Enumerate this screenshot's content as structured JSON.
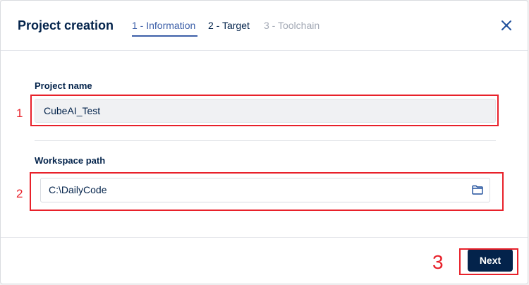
{
  "dialog": {
    "title": "Project creation",
    "close_icon": "close-icon"
  },
  "tabs": [
    {
      "label": "1 - Information",
      "state": "active"
    },
    {
      "label": "2 - Target",
      "state": "enabled"
    },
    {
      "label": "3 - Toolchain",
      "state": "disabled"
    }
  ],
  "form": {
    "project_name": {
      "label": "Project name",
      "value": "CubeAI_Test"
    },
    "workspace_path": {
      "label": "Workspace path",
      "value": "C:\\DailyCode",
      "browse_icon": "folder-icon"
    }
  },
  "footer": {
    "next_label": "Next"
  },
  "annotations": [
    {
      "number": "1"
    },
    {
      "number": "2"
    },
    {
      "number": "3"
    }
  ],
  "colors": {
    "primary": "#03234b",
    "accent": "#3c5fa8",
    "annotation": "#e8212a",
    "disabled": "#a3a9b5"
  }
}
